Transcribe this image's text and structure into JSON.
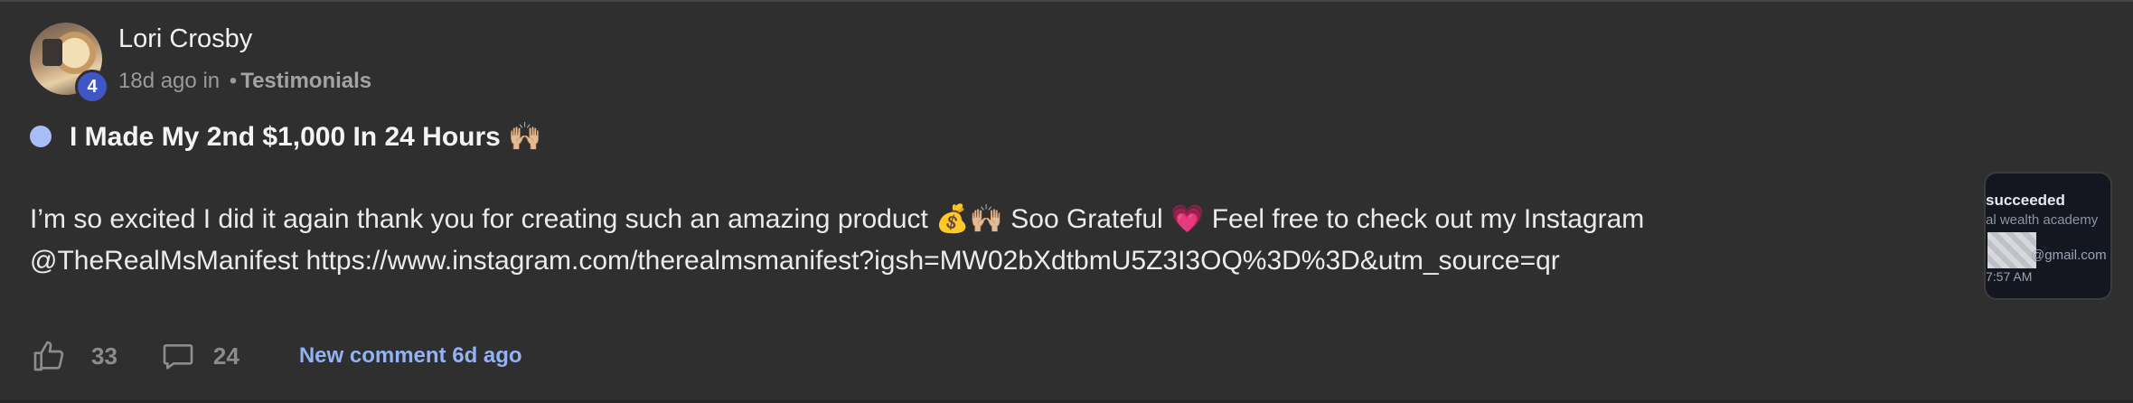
{
  "post": {
    "author": "Lori Crosby",
    "level": "4",
    "time_ago": "18d ago",
    "in_label": "in",
    "separator": "•",
    "category": "Testimonials",
    "title": "I Made My 2nd $1,000 In 24 Hours 🙌🏼",
    "body_line1": "I’m so excited I did it again thank you for creating such an amazing product 💰🙌🏼 Soo Grateful 💗 Feel free to check out my Instagram",
    "body_line2": "@TheRealMsManifest https://www.instagram.com/therealmsmanifest?igsh=MW02bXdtbmU5Z3I3OQ%3D%3D&utm_source=qr"
  },
  "thumbnail": {
    "line1": "succeeded",
    "line2": "al wealth academy",
    "line3": "@gmail.com",
    "line4": "7:57 AM"
  },
  "footer": {
    "like_count": "33",
    "comment_count": "24",
    "new_comment": "New comment 6d ago"
  },
  "icons": {
    "like": "thumbs-up-icon",
    "comment": "comment-bubble-icon",
    "unread": "unread-dot-icon"
  },
  "colors": {
    "background": "#2f2f2f",
    "badge": "#3f56c6",
    "unread_dot": "#a8bdf7",
    "link": "#93b2f5"
  }
}
